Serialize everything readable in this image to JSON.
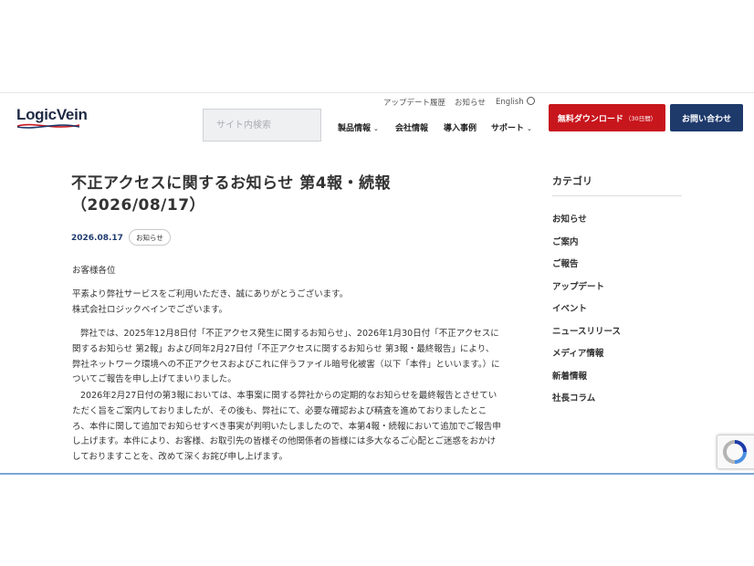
{
  "header": {
    "logo_text": "LogicVein",
    "search_placeholder": "サイト内検索",
    "utility_links": [
      "アップデート履歴",
      "お知らせ"
    ],
    "language": "English",
    "nav": [
      "製品情報",
      "会社情報",
      "導入事例",
      "サポート"
    ],
    "download_button": "無料ダウンロード",
    "download_note": "（30日間）",
    "contact_button": "お問い合わせ"
  },
  "article": {
    "title_line1": "不正アクセスに関するお知らせ 第4報・続報",
    "title_line2": "（2026/08/17）",
    "date": "2026.08.17",
    "category_badge": "お知らせ",
    "salutation": "お客様各位",
    "greeting_line1": "平素より弊社サービスをご利用いただき、誠にありがとうございます。",
    "greeting_line2": "株式会社ロジックベインでございます。",
    "para1": "弊社では、2025年12月8日付「不正アクセス発生に関するお知らせ」、2026年1月30日付「不正アクセスに関するお知らせ 第2報」および同年2月27日付「不正アクセスに関するお知らせ 第3報・最終報告」により、弊社ネットワーク環境への不正アクセスおよびこれに伴うファイル暗号化被害（以下「本件」といいます。）についてご報告を申し上げてまいりました。",
    "para2": "2026年2月27日付の第3報においては、本事案に関する弊社からの定期的なお知らせを最終報告とさせていただく旨をご案内しておりましたが、その後も、弊社にて、必要な確認および精査を進めておりましたところ、本件に関して追加でお知らせすべき事実が判明いたしましたので、本第4報・続報において追加でご報告申し上げます。本件により、お客様、お取引先の皆様その他関係者の皆様には多大なるご心配とご迷惑をおかけしておりますことを、改めて深くお詫び申し上げます。"
  },
  "sidebar": {
    "title": "カテゴリ",
    "items": [
      "お知らせ",
      "ご案内",
      "ご報告",
      "アップデート",
      "イベント",
      "ニュースリリース",
      "メディア情報",
      "新着情報",
      "社長コラム"
    ]
  },
  "colors": {
    "accent_red": "#c8161d",
    "navy": "#1e3a6b"
  }
}
